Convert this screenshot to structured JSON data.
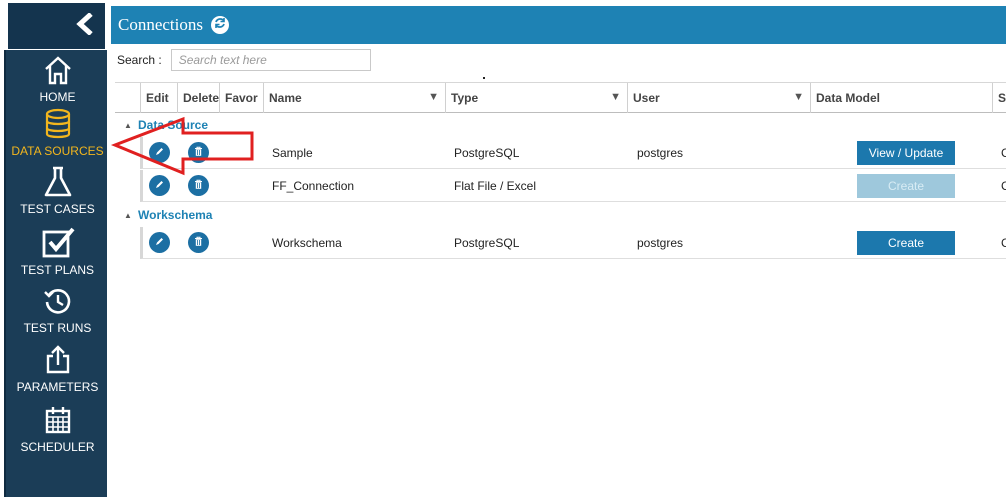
{
  "sidebar": {
    "collapse_icon": "chevron-left-icon",
    "items": [
      {
        "label": "HOME",
        "icon": "home-icon",
        "active": false
      },
      {
        "label": "DATA SOURCES",
        "icon": "database-icon",
        "active": true
      },
      {
        "label": "TEST CASES",
        "icon": "flask-icon",
        "active": false
      },
      {
        "label": "TEST PLANS",
        "icon": "checkbox-icon",
        "active": false
      },
      {
        "label": "TEST RUNS",
        "icon": "history-icon",
        "active": false
      },
      {
        "label": "PARAMETERS",
        "icon": "export-icon",
        "active": false
      },
      {
        "label": "SCHEDULER",
        "icon": "calendar-icon",
        "active": false
      }
    ],
    "active_color": "#f2b61e",
    "background": "#1b3d57"
  },
  "header": {
    "title": "Connections",
    "refresh_icon": "refresh-icon",
    "color": "#1e82b4"
  },
  "search": {
    "label": "Search :",
    "placeholder": "Search text here",
    "value": ""
  },
  "grid": {
    "columns": [
      "Edit",
      "Delete",
      "Favor",
      "Name",
      "Type",
      "User",
      "Data Model",
      "St"
    ],
    "groups": [
      {
        "name": "Data Source",
        "rows": [
          {
            "name": "Sample",
            "type": "PostgreSQL",
            "user": "postgres",
            "action": "View / Update",
            "action_enabled": true,
            "status": "Co"
          },
          {
            "name": "FF_Connection",
            "type": "Flat File / Excel",
            "user": "",
            "action": "Create",
            "action_enabled": false,
            "status": "Co"
          }
        ]
      },
      {
        "name": "Workschema",
        "rows": [
          {
            "name": "Workschema",
            "type": "PostgreSQL",
            "user": "postgres",
            "action": "Create",
            "action_enabled": true,
            "status": "Co"
          }
        ]
      }
    ]
  },
  "annotation": {
    "arrow_color": "#e02020"
  }
}
